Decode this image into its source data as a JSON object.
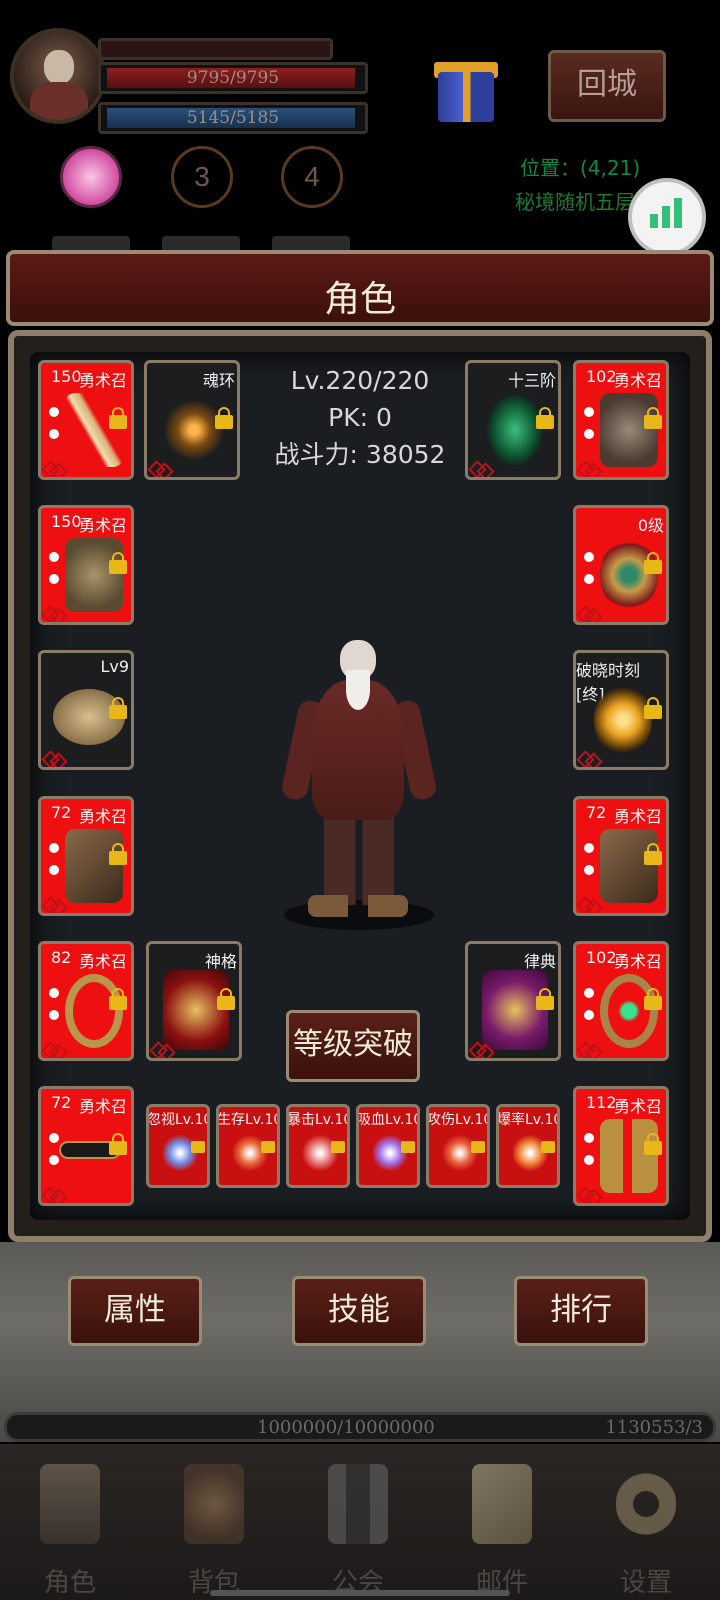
{
  "hud": {
    "hp_text": "9795/9795",
    "mp_text": "5145/5185",
    "buff_3": "3",
    "buff_4": "4",
    "return_label": "回城",
    "location": "位置：(4,21)",
    "status": "秘境随机五层"
  },
  "panel": {
    "title": "角色",
    "level": "Lv.220/220",
    "pk": "PK:  0",
    "power": "战斗力:  38052",
    "breakthrough": "等级突破"
  },
  "slots": {
    "weapon": {
      "lvl": "150",
      "cls": "勇术召"
    },
    "soul_ring": {
      "tag": "魂环"
    },
    "tree": {
      "tag": "十三阶"
    },
    "helmet": {
      "lvl": "102",
      "cls": "勇术召"
    },
    "armor": {
      "lvl": "150",
      "cls": "勇术召"
    },
    "necklace": {
      "tag": "0级"
    },
    "hat": {
      "tag": "Lv9"
    },
    "orb": {
      "tag": "破晓时刻[终]"
    },
    "glove_l": {
      "lvl": "72",
      "cls": "勇术召"
    },
    "glove_r": {
      "lvl": "72",
      "cls": "勇术召"
    },
    "ring_l": {
      "lvl": "82",
      "cls": "勇术召"
    },
    "divinity": {
      "tag": "神格"
    },
    "codex": {
      "tag": "律典"
    },
    "ring_r": {
      "lvl": "102",
      "cls": "勇术召"
    },
    "belt": {
      "lvl": "72",
      "cls": "勇术召"
    },
    "boots": {
      "lvl": "112",
      "cls": "勇术召"
    }
  },
  "gems": [
    {
      "name": "忽视Lv.10",
      "color": "#6f8ce8"
    },
    {
      "name": "生存Lv.10",
      "color": "#e86a3a"
    },
    {
      "name": "暴击Lv.10",
      "color": "#e87a7a"
    },
    {
      "name": "吸血Lv.10",
      "color": "#a070e8"
    },
    {
      "name": "攻伤Lv.10",
      "color": "#e8603a"
    },
    {
      "name": "爆率Lv.10",
      "color": "#f08a3a"
    }
  ],
  "actions": {
    "attributes": "属性",
    "skills": "技能",
    "ranking": "排行"
  },
  "xp": {
    "text": "1000000/10000000",
    "right": "1130553/3"
  },
  "nav": [
    {
      "label": "角色",
      "icon": "character-icon"
    },
    {
      "label": "背包",
      "icon": "bag-icon"
    },
    {
      "label": "公会",
      "icon": "guild-icon"
    },
    {
      "label": "邮件",
      "icon": "mail-icon"
    },
    {
      "label": "设置",
      "icon": "settings-gear-icon"
    }
  ]
}
